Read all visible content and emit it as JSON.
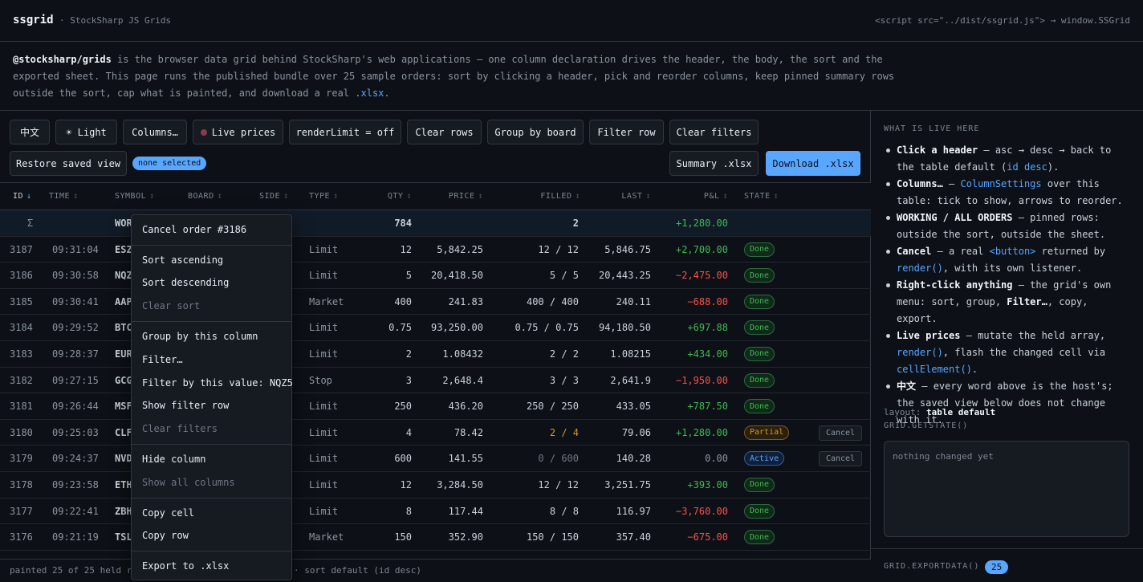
{
  "header": {
    "brand": "ssgrid",
    "subtitle": "· StockSharp JS Grids",
    "script_hint": "<script src=\"../dist/ssgrid.js\"> → window.SSGrid"
  },
  "intro": {
    "package": "@stocksharp/grids",
    "text_1": " is the browser data grid behind StockSharp's web applications — one column declaration drives the header, the body, the sort and the",
    "text_2": "exported sheet. This page runs the published bundle over 25 sample orders: sort by clicking a header, pick and reorder columns, keep pinned summary rows",
    "text_3": "outside the sort, cap what is painted, and download a real ",
    "xlsx": ".xlsx",
    "text_4": "."
  },
  "toolbar": {
    "lang": "中文",
    "theme": "☀ Light",
    "columns": "Columns…",
    "live": "Live prices",
    "render_limit": "renderLimit = off",
    "clear_rows": "Clear rows",
    "group_board": "Group by board",
    "filter_row": "Filter row",
    "clear_filters": "Clear filters",
    "restore": "Restore saved view",
    "selection": "none selected",
    "summary_xlsx": "Summary .xlsx",
    "download_xlsx": "Download .xlsx"
  },
  "columns": {
    "id": "ID",
    "time": "TIME",
    "symbol": "SYMBOL",
    "board": "BOARD",
    "side": "SIDE",
    "type": "TYPE",
    "qty": "QTY",
    "price": "PRICE",
    "filled": "FILLED",
    "last": "LAST",
    "pnl": "P&L",
    "state": "STATE",
    "sort_active_icon": "↓",
    "sort_icon": "↕"
  },
  "summary_row": {
    "sigma": "Σ",
    "label": "WOR",
    "qty": "784",
    "filled": "2",
    "pnl": "+1,280.00"
  },
  "rows": [
    {
      "id": "3187",
      "time": "09:31:04",
      "symbol": "ESZ",
      "type": "Limit",
      "qty": "12",
      "price": "5,842.25",
      "filled": "12 / 12",
      "last": "5,846.75",
      "pnl": "+2,700.00",
      "state": "Done"
    },
    {
      "id": "3186",
      "time": "09:30:58",
      "symbol": "NQZ",
      "type": "Limit",
      "qty": "5",
      "price": "20,418.50",
      "filled": "5 / 5",
      "last": "20,443.25",
      "pnl": "−2,475.00",
      "state": "Done"
    },
    {
      "id": "3185",
      "time": "09:30:41",
      "symbol": "AAP",
      "type": "Market",
      "qty": "400",
      "price": "241.83",
      "filled": "400 / 400",
      "last": "240.11",
      "pnl": "−688.00",
      "state": "Done"
    },
    {
      "id": "3184",
      "time": "09:29:52",
      "symbol": "BTC",
      "type": "Limit",
      "qty": "0.75",
      "price": "93,250.00",
      "filled": "0.75 / 0.75",
      "last": "94,180.50",
      "pnl": "+697.88",
      "state": "Done"
    },
    {
      "id": "3183",
      "time": "09:28:37",
      "symbol": "EUR",
      "type": "Limit",
      "qty": "2",
      "price": "1.08432",
      "filled": "2 / 2",
      "last": "1.08215",
      "pnl": "+434.00",
      "state": "Done"
    },
    {
      "id": "3182",
      "time": "09:27:15",
      "symbol": "GCG",
      "type": "Stop",
      "qty": "3",
      "price": "2,648.4",
      "filled": "3 / 3",
      "last": "2,641.9",
      "pnl": "−1,950.00",
      "state": "Done"
    },
    {
      "id": "3181",
      "time": "09:26:44",
      "symbol": "MSF",
      "type": "Limit",
      "qty": "250",
      "price": "436.20",
      "filled": "250 / 250",
      "last": "433.05",
      "pnl": "+787.50",
      "state": "Done"
    },
    {
      "id": "3180",
      "time": "09:25:03",
      "symbol": "CLF",
      "type": "Limit",
      "qty": "4",
      "price": "78.42",
      "filled": "2 / 4",
      "last": "79.06",
      "pnl": "+1,280.00",
      "state": "Partial",
      "cancel": "Cancel"
    },
    {
      "id": "3179",
      "time": "09:24:37",
      "symbol": "NVD",
      "type": "Limit",
      "qty": "600",
      "price": "141.55",
      "filled": "0 / 600",
      "last": "140.28",
      "pnl": "0.00",
      "state": "Active",
      "cancel": "Cancel"
    },
    {
      "id": "3178",
      "time": "09:23:58",
      "symbol": "ETH",
      "type": "Limit",
      "qty": "12",
      "price": "3,284.50",
      "filled": "12 / 12",
      "last": "3,251.75",
      "pnl": "+393.00",
      "state": "Done"
    },
    {
      "id": "3177",
      "time": "09:22:41",
      "symbol": "ZBH",
      "type": "Limit",
      "qty": "8",
      "price": "117.44",
      "filled": "8 / 8",
      "last": "116.97",
      "pnl": "−3,760.00",
      "state": "Done"
    },
    {
      "id": "3176",
      "time": "09:21:19",
      "symbol": "TSL",
      "type": "Market",
      "qty": "150",
      "price": "352.90",
      "filled": "150 / 150",
      "last": "357.40",
      "pnl": "−675.00",
      "state": "Done"
    }
  ],
  "footer": {
    "painted": "painted 25 of 25 held ro",
    "sort": "· sort default (id desc)"
  },
  "context_menu": {
    "cancel_order": "Cancel order #3186",
    "sort_asc": "Sort ascending",
    "sort_desc": "Sort descending",
    "clear_sort": "Clear sort",
    "group_col": "Group by this column",
    "filter": "Filter…",
    "filter_value": "Filter by this value: NQZ5",
    "show_filter_row": "Show filter row",
    "clear_filters": "Clear filters",
    "hide_column": "Hide column",
    "show_all": "Show all columns",
    "copy_cell": "Copy cell",
    "copy_row": "Copy row",
    "export": "Export to .xlsx"
  },
  "sidebar": {
    "heading": "WHAT IS LIVE HERE",
    "items": [
      {
        "bold": "Click a header",
        "t1": " — asc → desc → back to the table default (",
        "code": "id desc",
        "t2": ")."
      },
      {
        "bold": "Columns…",
        "t1": " — ",
        "code": "ColumnSettings",
        "t2": " over this table: tick to show, arrows to reorder."
      },
      {
        "bold": "WORKING / ALL ORDERS",
        "t1": " — pinned rows: outside the sort, outside the sheet.",
        "code": "",
        "t2": ""
      },
      {
        "bold": "Cancel",
        "t1": " — a real ",
        "code": "<button>",
        "t2": " returned by ",
        "code2": "render()",
        "t3": ", with its own listener."
      },
      {
        "bold": "Right-click anything",
        "t1": " — the grid's own menu: sort, group, ",
        "bold2": "Filter…",
        "t2": ", copy, export."
      },
      {
        "bold": "Live prices",
        "t1": " — mutate the held array, ",
        "code": "render()",
        "t2": ", flash the changed cell via ",
        "code2": "cellElement()",
        "t3": "."
      },
      {
        "bold": "中文",
        "t1": " — every word above is the host's; the saved view below does not change with it.",
        "code": "",
        "t2": ""
      }
    ],
    "layout_label": "layout:",
    "layout_value": "table default",
    "getstate": "GRID.GETSTATE()",
    "state_text": "nothing changed yet",
    "exportdata": "GRID.EXPORTDATA()",
    "export_count": "25"
  },
  "colors": {
    "accent": "#58a6ff",
    "positive": "#3fb950",
    "negative": "#f85149",
    "partial": "#d29922"
  }
}
